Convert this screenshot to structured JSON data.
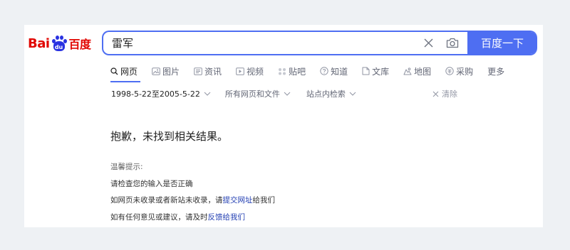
{
  "logo": {
    "bai": "Bai",
    "du_paw": "du",
    "cn": "百度"
  },
  "search": {
    "query": "雷军",
    "button_label": "百度一下"
  },
  "tabs": [
    {
      "label": "网页",
      "icon": "search-icon",
      "active": true
    },
    {
      "label": "图片",
      "icon": "image-icon",
      "active": false
    },
    {
      "label": "资讯",
      "icon": "news-icon",
      "active": false
    },
    {
      "label": "视频",
      "icon": "video-icon",
      "active": false
    },
    {
      "label": "贴吧",
      "icon": "tieba-icon",
      "active": false
    },
    {
      "label": "知道",
      "icon": "question-icon",
      "active": false
    },
    {
      "label": "文库",
      "icon": "document-icon",
      "active": false
    },
    {
      "label": "地图",
      "icon": "map-icon",
      "active": false
    },
    {
      "label": "采购",
      "icon": "purchase-icon",
      "active": false
    },
    {
      "label": "更多",
      "icon": "",
      "active": false
    }
  ],
  "filters": {
    "date_range": "1998-5-22至2005-5-22",
    "file_type": "所有网页和文件",
    "site_search": "站点内检索",
    "clear": "清除"
  },
  "result": {
    "message": "抱歉，未找到相关结果。",
    "tips_title": "温馨提示:",
    "tip1": "请检查您的输入是否正确",
    "tip2_prefix": "如网页未收录或者新站未收录，请",
    "tip2_link": "提交网址",
    "tip2_suffix": "给我们",
    "tip3_prefix": "如有任何意见或建议，请及时",
    "tip3_link": "反馈给我们"
  },
  "colors": {
    "brand_blue": "#4e6ef2",
    "logo_red": "#e10601",
    "logo_paw": "#2932e1",
    "link": "#2440b3"
  }
}
